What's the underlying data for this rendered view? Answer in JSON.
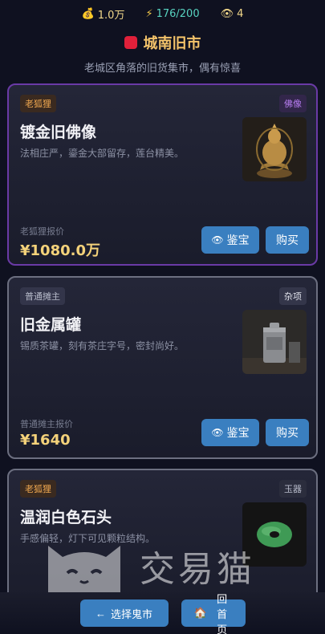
{
  "status": {
    "coins": "1.0万",
    "energy": "176/200",
    "eyes": "4"
  },
  "market": {
    "name": "城南旧市",
    "subtitle": "老城区角落的旧货集市，偶有惊喜"
  },
  "items": [
    {
      "seller": "老狐狸",
      "category": "佛像",
      "name": "镀金旧佛像",
      "desc": "法相庄严，鎏金大部留存，莲台精美。",
      "price_label": "老狐狸报价",
      "price": "¥1080.0万",
      "appraise_label": "鉴宝",
      "buy_label": "购买"
    },
    {
      "seller": "普通摊主",
      "category": "杂项",
      "name": "旧金属罐",
      "desc": "锡质茶罐，刻有茶庄字号，密封尚好。",
      "price_label": "普通摊主报价",
      "price": "¥1640",
      "appraise_label": "鉴宝",
      "buy_label": "购买"
    },
    {
      "seller": "老狐狸",
      "category": "玉器",
      "name": "温润白色石头",
      "desc": "手感偏轻，灯下可见颗粒结构。"
    }
  ],
  "watermark": "交易猫",
  "nav": {
    "back_label": "选择鬼市",
    "home_label": "回首页"
  }
}
